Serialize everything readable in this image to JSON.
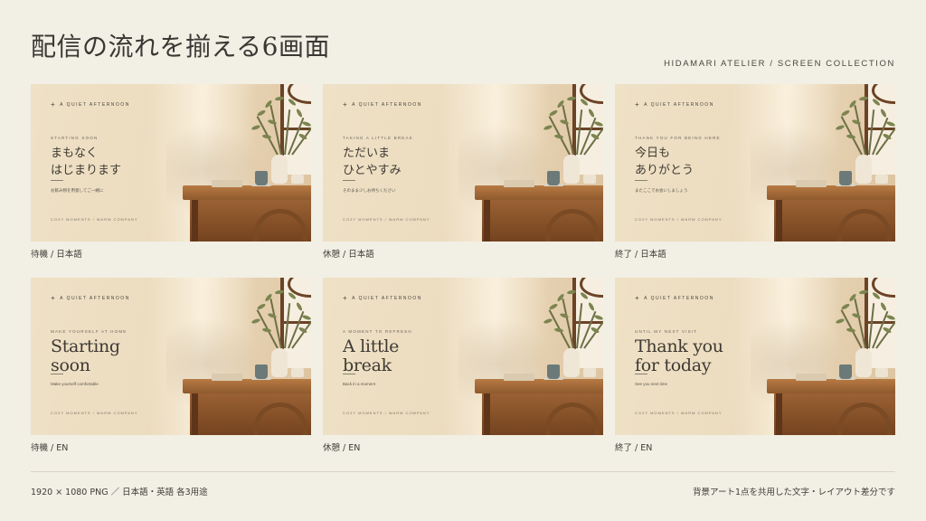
{
  "page_title": "配信の流れを揃える6画面",
  "brand_line": "HIDAMARI ATELIER / SCREEN COLLECTION",
  "overlay_brand": "A QUIET AFTERNOON",
  "overlay_footer": "COZY MOMENTS / WARM COMPANY",
  "cards": [
    {
      "caption": "待機 / 日本語",
      "lang": "ja",
      "sub": "STARTING SOON",
      "heading_lines": [
        "まもなく",
        "はじまります"
      ],
      "desc": "お飲み物を用意してご一緒に"
    },
    {
      "caption": "休憩 / 日本語",
      "lang": "ja",
      "sub": "TAKING A LITTLE BREAK",
      "heading_lines": [
        "ただいま",
        "ひとやすみ"
      ],
      "desc": "そのまま少しお待ちください"
    },
    {
      "caption": "終了 / 日本語",
      "lang": "ja",
      "sub": "THANK YOU FOR BEING HERE",
      "heading_lines": [
        "今日も",
        "ありがとう"
      ],
      "desc": "またここでお会いしましょう"
    },
    {
      "caption": "待機 / EN",
      "lang": "en",
      "sub": "MAKE YOURSELF AT HOME",
      "heading_lines": [
        "Starting",
        "soon"
      ],
      "desc": "Make yourself comfortable"
    },
    {
      "caption": "休憩 / EN",
      "lang": "en",
      "sub": "A MOMENT TO REFRESH",
      "heading_lines": [
        "A little",
        "break"
      ],
      "desc": "Back in a moment"
    },
    {
      "caption": "終了 / EN",
      "lang": "en",
      "sub": "UNTIL MY NEXT VISIT",
      "heading_lines": [
        "Thank you",
        "for today"
      ],
      "desc": "See you next time"
    }
  ],
  "footer": {
    "left": "1920 × 1080 PNG ／ 日本語・英語 各3用途",
    "right": "背景アート1点を共用した文字・レイアウト差分です"
  },
  "colors": {
    "background": "#f2efe4",
    "text": "#3c3a36",
    "wood": "#8f5a2e"
  }
}
